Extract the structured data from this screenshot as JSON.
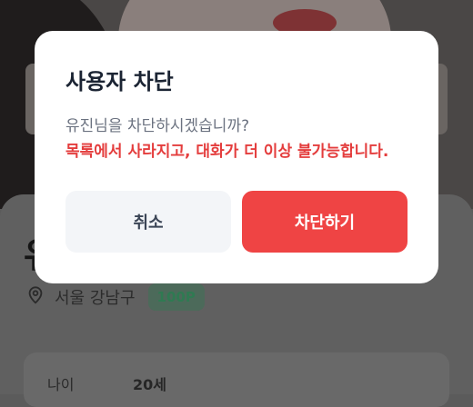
{
  "background": {
    "name_initial": "유",
    "location": "서울 강남구",
    "points": "100P",
    "info_label": "나이",
    "info_value": "20세"
  },
  "dialog": {
    "title": "사용자 차단",
    "message": "유진님을 차단하시겠습니까?",
    "warning": "목록에서 사라지고, 대화가 더 이상 불가능합니다.",
    "cancel_label": "취소",
    "confirm_label": "차단하기"
  },
  "colors": {
    "danger": "#ef4444",
    "warning_text": "#e43d3d",
    "cancel_bg": "#f3f5f8"
  }
}
